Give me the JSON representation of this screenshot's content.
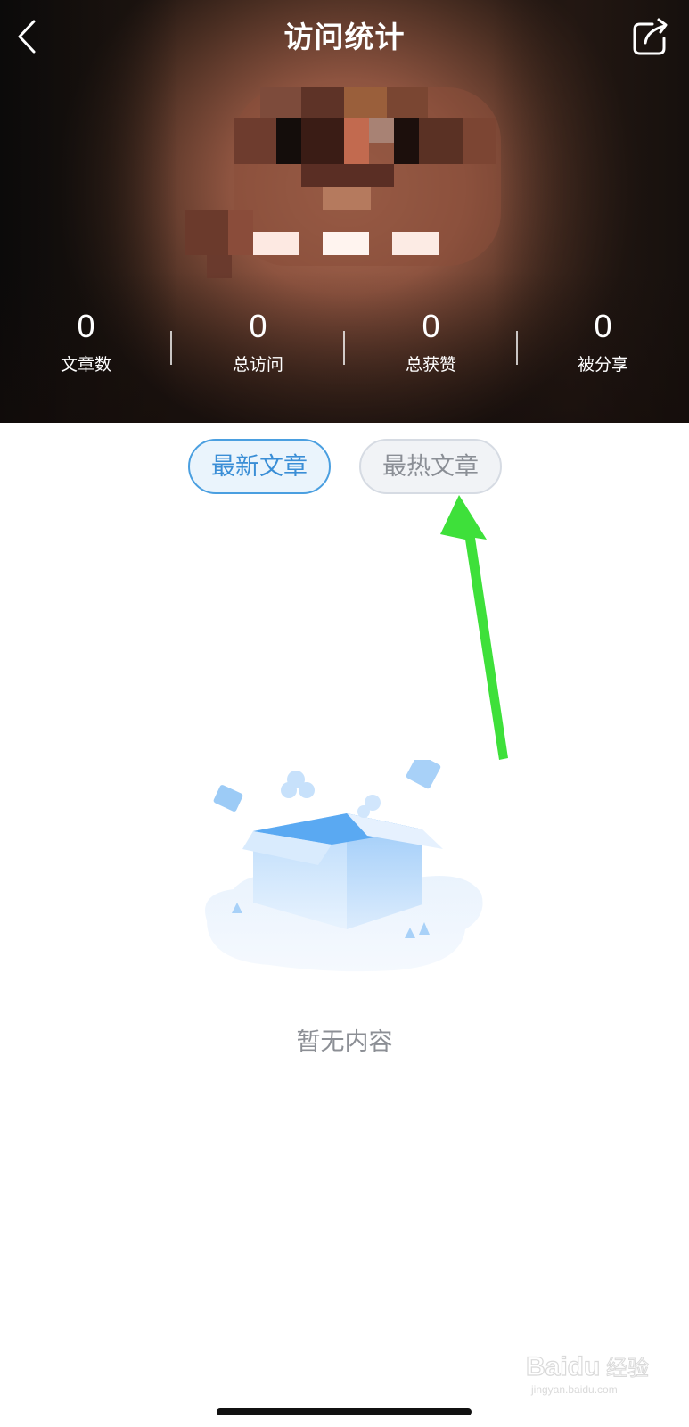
{
  "header": {
    "title": "访问统计",
    "back_icon": "chevron-left-icon",
    "share_icon": "share-icon"
  },
  "stats": [
    {
      "value": "0",
      "label": "文章数"
    },
    {
      "value": "0",
      "label": "总访问"
    },
    {
      "value": "0",
      "label": "总获赞"
    },
    {
      "value": "0",
      "label": "被分享"
    }
  ],
  "tabs": {
    "latest": {
      "label": "最新文章",
      "active": true
    },
    "hot": {
      "label": "最热文章",
      "active": false
    }
  },
  "empty_state": {
    "illustration": "empty-box-icon",
    "text": "暂无内容"
  },
  "colors": {
    "accent": "#3a8ed6",
    "arrow": "#3ee03a",
    "inactive_text": "#8b8f96"
  },
  "watermark": {
    "brand": "Baidu",
    "sub_label": "经验",
    "url": "jingyan.baidu.com"
  }
}
